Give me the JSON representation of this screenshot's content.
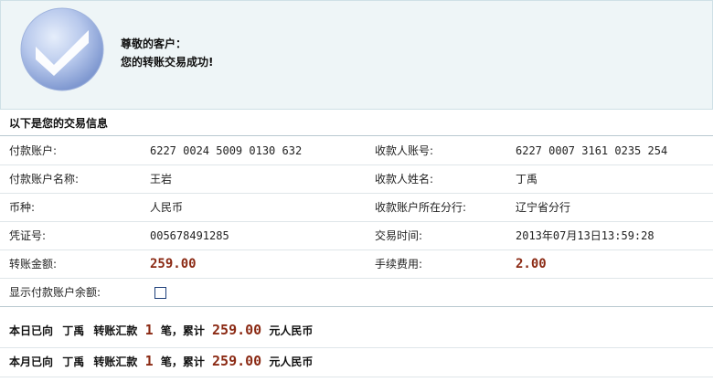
{
  "banner": {
    "greeting": "尊敬的客户：",
    "message": "您的转账交易成功!",
    "icon": "checkmark-icon"
  },
  "section_title": "以下是您的交易信息",
  "rows": [
    {
      "label1": "付款账户:",
      "value1": "6227 0024 5009 0130 632",
      "label2": "收款人账号:",
      "value2": "6227 0007 3161 0235 254"
    },
    {
      "label1": "付款账户名称:",
      "value1": "王岩",
      "label2": "收款人姓名:",
      "value2": "丁禹"
    },
    {
      "label1": "币种:",
      "value1": "人民币",
      "label2": "收款账户所在分行:",
      "value2": "辽宁省分行"
    },
    {
      "label1": "凭证号:",
      "value1": "005678491285",
      "label2": "交易时间:",
      "value2": "2013年07月13日13:59:28"
    },
    {
      "label1": "转账金额:",
      "value1": "259.00",
      "label2": "手续费用:",
      "value2": "2.00"
    }
  ],
  "balance_toggle": {
    "label": "显示付款账户余额:",
    "checked": false
  },
  "summary_day": {
    "prefix": "本日已向",
    "payee": "丁禹",
    "action": "转账汇款",
    "count": "1",
    "mid": "笔，累计",
    "total": "259.00",
    "unit": "元人民币"
  },
  "summary_month": {
    "prefix": "本月已向",
    "payee": "丁禹",
    "action": "转账汇款",
    "count": "1",
    "mid": "笔，累计",
    "total": "259.00",
    "unit": "元人民币"
  },
  "colors": {
    "amount": "#8b2a14",
    "banner_bg": "#eef5f7",
    "checkbox_border": "#1e3f7a"
  }
}
